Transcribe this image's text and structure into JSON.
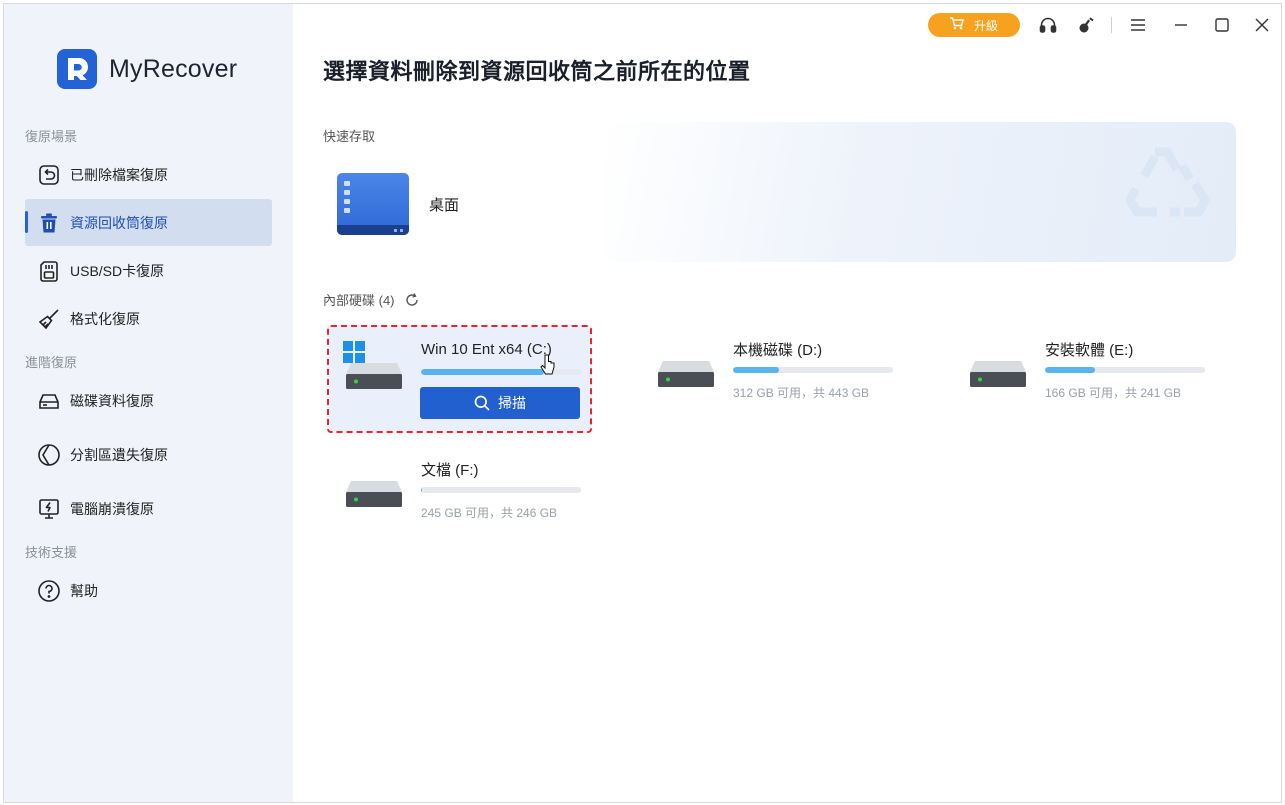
{
  "app": {
    "name": "MyRecover",
    "brand_color": "#2463d6",
    "accent_color": "#f6a21e"
  },
  "titlebar": {
    "upgrade_label": "升級",
    "icons": [
      "headset-icon",
      "key-icon",
      "menu-icon",
      "minimize-icon",
      "maximize-icon",
      "close-icon"
    ]
  },
  "sidebar": {
    "sections": [
      {
        "label": "復原場景"
      },
      {
        "label": "進階復原"
      },
      {
        "label": "技術支援"
      }
    ],
    "items": [
      {
        "label": "已刪除檔案復原",
        "icon": "undo-file-icon",
        "active": false
      },
      {
        "label": "資源回收筒復原",
        "icon": "trash-icon",
        "active": true
      },
      {
        "label": "USB/SD卡復原",
        "icon": "sd-card-icon",
        "active": false
      },
      {
        "label": "格式化復原",
        "icon": "broom-icon",
        "active": false
      },
      {
        "label": "磁碟資料復原",
        "icon": "hard-drive-icon",
        "active": false
      },
      {
        "label": "分割區遺失復原",
        "icon": "partition-icon",
        "active": false
      },
      {
        "label": "電腦崩潰復原",
        "icon": "crashed-monitor-icon",
        "active": false
      },
      {
        "label": "幫助",
        "icon": "help-icon",
        "active": false
      }
    ]
  },
  "main": {
    "title": "選擇資料刪除到資源回收筒之前所在的位置",
    "quick_access": {
      "label": "快速存取",
      "items": [
        {
          "label": "桌面",
          "icon": "desktop-folder-icon"
        }
      ]
    },
    "disks": {
      "label": "內部硬碟 (4)",
      "items": [
        {
          "name": "Win 10 Ent x64 (C:)",
          "info": "",
          "used_fraction": 0.77,
          "selected": true,
          "system": true,
          "scan_label": "掃描"
        },
        {
          "name": "本機磁碟 (D:)",
          "info": "312 GB 可用，共 443 GB",
          "used_fraction": 0.29,
          "selected": false
        },
        {
          "name": "安裝軟體 (E:)",
          "info": "166 GB 可用，共 241 GB",
          "used_fraction": 0.31,
          "selected": false
        },
        {
          "name": "文檔 (F:)",
          "info": "245 GB 可用，共 246 GB",
          "used_fraction": 0.005,
          "selected": false
        }
      ]
    }
  }
}
